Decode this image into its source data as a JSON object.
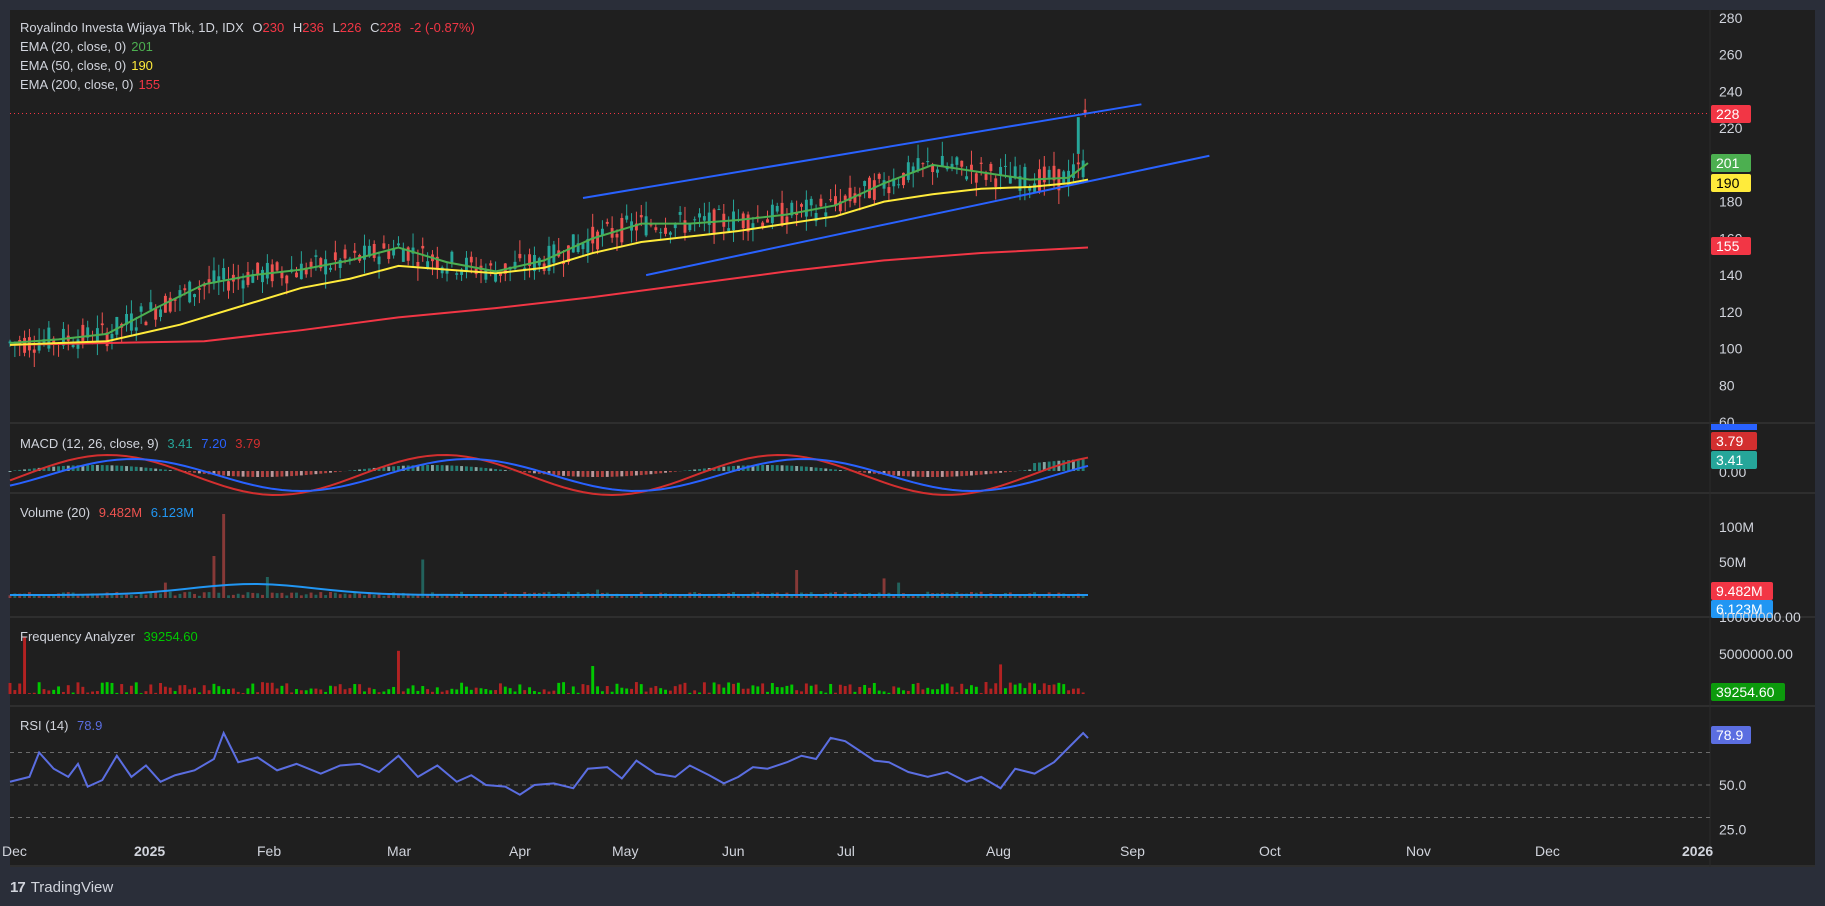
{
  "header": {
    "symbol": "Royalindo Investa Wijaya Tbk, 1D, IDX",
    "o_label": "O",
    "o_val": "230",
    "h_label": "H",
    "h_val": "236",
    "l_label": "L",
    "l_val": "226",
    "c_label": "C",
    "c_val": "228",
    "change": "-2 (-0.87%)"
  },
  "ema_legend": [
    {
      "label": "EMA (20, close, 0)",
      "value": "201",
      "color": "#4caf50"
    },
    {
      "label": "EMA (50, close, 0)",
      "value": "190",
      "color": "#ffeb3b"
    },
    {
      "label": "EMA (200, close, 0)",
      "value": "155",
      "color": "#f23645"
    }
  ],
  "macd_legend": {
    "label": "MACD (12, 26, close, 9)",
    "hist": "3.41",
    "macd": "7.20",
    "signal": "3.79"
  },
  "volume_legend": {
    "label": "Volume (20)",
    "vol": "9.482M",
    "ma": "6.123M"
  },
  "freq_legend": {
    "label": "Frequency Analyzer",
    "value": "39254.60"
  },
  "rsi_legend": {
    "label": "RSI (14)",
    "value": "78.9"
  },
  "colors": {
    "up": "#26a69a",
    "down": "#ef5350",
    "ema20": "#4caf50",
    "ema50": "#ffeb3b",
    "ema200": "#f23645",
    "channel": "#2962ff",
    "macd": "#2962ff",
    "signal": "#d32f2f",
    "rsi": "#7e57c2",
    "freq_up": "#00c800",
    "freq_down": "#b22222"
  },
  "footer": {
    "brand": "TradingView",
    "logo": "17"
  },
  "chart_data": {
    "type": "candlestick",
    "x_axis_labels": [
      "Dec",
      "2025",
      "Feb",
      "Mar",
      "Apr",
      "May",
      "Jun",
      "Jul",
      "Aug",
      "Sep",
      "Oct",
      "Nov",
      "Dec",
      "2026"
    ],
    "price_axis": {
      "ticks": [
        "280",
        "260",
        "240",
        "220",
        "180",
        "160",
        "140",
        "120",
        "100",
        "80",
        "60"
      ],
      "ylim": [
        60,
        280
      ]
    },
    "last_price": 228,
    "price_badges": [
      {
        "text": "228",
        "value": 228,
        "color": "#f23645"
      },
      {
        "text": "201",
        "value": 201,
        "color": "#4caf50"
      },
      {
        "text": "190",
        "value": 190,
        "color": "#ffeb3b"
      },
      {
        "text": "155",
        "value": 155,
        "color": "#f23645"
      }
    ],
    "ema20_points": [
      [
        0,
        103
      ],
      [
        10,
        105
      ],
      [
        20,
        108
      ],
      [
        30,
        122
      ],
      [
        40,
        135
      ],
      [
        50,
        140
      ],
      [
        60,
        143
      ],
      [
        70,
        148
      ],
      [
        80,
        155
      ],
      [
        90,
        147
      ],
      [
        100,
        142
      ],
      [
        110,
        148
      ],
      [
        120,
        160
      ],
      [
        130,
        168
      ],
      [
        140,
        168
      ],
      [
        150,
        170
      ],
      [
        160,
        173
      ],
      [
        170,
        178
      ],
      [
        180,
        190
      ],
      [
        190,
        200
      ],
      [
        200,
        196
      ],
      [
        210,
        192
      ],
      [
        218,
        193
      ],
      [
        222,
        201
      ]
    ],
    "ema50_points": [
      [
        0,
        102
      ],
      [
        20,
        104
      ],
      [
        35,
        113
      ],
      [
        50,
        125
      ],
      [
        60,
        133
      ],
      [
        70,
        138
      ],
      [
        80,
        145
      ],
      [
        90,
        143
      ],
      [
        100,
        141
      ],
      [
        110,
        144
      ],
      [
        120,
        152
      ],
      [
        130,
        158
      ],
      [
        140,
        161
      ],
      [
        150,
        164
      ],
      [
        160,
        168
      ],
      [
        170,
        172
      ],
      [
        180,
        180
      ],
      [
        190,
        184
      ],
      [
        200,
        187
      ],
      [
        210,
        188
      ],
      [
        218,
        190
      ],
      [
        222,
        192
      ]
    ],
    "ema200_points": [
      [
        0,
        102
      ],
      [
        40,
        104
      ],
      [
        60,
        110
      ],
      [
        80,
        117
      ],
      [
        100,
        122
      ],
      [
        120,
        128
      ],
      [
        140,
        135
      ],
      [
        160,
        142
      ],
      [
        180,
        148
      ],
      [
        200,
        152
      ],
      [
        222,
        155
      ]
    ],
    "channel_upper": [
      [
        118,
        182
      ],
      [
        233,
        233
      ]
    ],
    "channel_lower": [
      [
        131,
        140
      ],
      [
        247,
        205
      ]
    ],
    "macd_axis": {
      "ticks": [
        "0.00"
      ]
    },
    "macd_badges": [
      {
        "text": "3.79",
        "color": "#d32f2f"
      },
      {
        "text": "3.41",
        "color": "#26a69a"
      }
    ],
    "volume_axis": {
      "ticks": [
        "100M",
        "50M"
      ]
    },
    "volume_badges": [
      {
        "text": "9.482M",
        "color": "#ef5350"
      },
      {
        "text": "6.123M",
        "color": "#2196f3"
      }
    ],
    "volume_spikes": [
      [
        42,
        60
      ],
      [
        44,
        120
      ],
      [
        32,
        22
      ],
      [
        53,
        30
      ],
      [
        85,
        55
      ],
      [
        121,
        12
      ],
      [
        162,
        40
      ],
      [
        180,
        28
      ],
      [
        183,
        22
      ]
    ],
    "freq_axis": {
      "ticks": [
        "10000000.00",
        "5000000.00"
      ]
    },
    "freq_badge": {
      "text": "39254.60",
      "color": "#0c9a0c"
    },
    "freq_spikes": [
      [
        3,
        7200000
      ],
      [
        80,
        5400000
      ],
      [
        120,
        3500000
      ],
      [
        204,
        3700000
      ]
    ],
    "rsi_axis": {
      "ticks": [
        "50.0",
        "25.0"
      ],
      "bands": [
        70,
        50,
        30
      ]
    },
    "rsi_badge": {
      "text": "78.9",
      "color": "#5b6ee1"
    },
    "rsi_points": [
      [
        0,
        52
      ],
      [
        4,
        55
      ],
      [
        6,
        70
      ],
      [
        9,
        60
      ],
      [
        12,
        55
      ],
      [
        14,
        63
      ],
      [
        16,
        49
      ],
      [
        19,
        53
      ],
      [
        22,
        68
      ],
      [
        25,
        55
      ],
      [
        28,
        62
      ],
      [
        31,
        52
      ],
      [
        34,
        56
      ],
      [
        38,
        59
      ],
      [
        42,
        66
      ],
      [
        44,
        82
      ],
      [
        47,
        64
      ],
      [
        51,
        67
      ],
      [
        55,
        59
      ],
      [
        59,
        63
      ],
      [
        64,
        57
      ],
      [
        68,
        62
      ],
      [
        72,
        63
      ],
      [
        76,
        58
      ],
      [
        80,
        68
      ],
      [
        84,
        55
      ],
      [
        88,
        62
      ],
      [
        92,
        52
      ],
      [
        95,
        56
      ],
      [
        98,
        50
      ],
      [
        102,
        49
      ],
      [
        105,
        44
      ],
      [
        108,
        50
      ],
      [
        112,
        51
      ],
      [
        116,
        48
      ],
      [
        119,
        60
      ],
      [
        123,
        61
      ],
      [
        126,
        54
      ],
      [
        129,
        65
      ],
      [
        133,
        57
      ],
      [
        137,
        55
      ],
      [
        140,
        62
      ],
      [
        144,
        56
      ],
      [
        147,
        51
      ],
      [
        150,
        55
      ],
      [
        153,
        61
      ],
      [
        156,
        60
      ],
      [
        160,
        64
      ],
      [
        163,
        68
      ],
      [
        166,
        66
      ],
      [
        169,
        79
      ],
      [
        172,
        77
      ],
      [
        175,
        71
      ],
      [
        178,
        65
      ],
      [
        181,
        64
      ],
      [
        185,
        58
      ],
      [
        189,
        55
      ],
      [
        193,
        58
      ],
      [
        197,
        52
      ],
      [
        200,
        55
      ],
      [
        204,
        48
      ],
      [
        207,
        60
      ],
      [
        211,
        57
      ],
      [
        215,
        64
      ],
      [
        218,
        73
      ],
      [
        221,
        82
      ],
      [
        222,
        78.9
      ]
    ],
    "x_count": 222
  }
}
